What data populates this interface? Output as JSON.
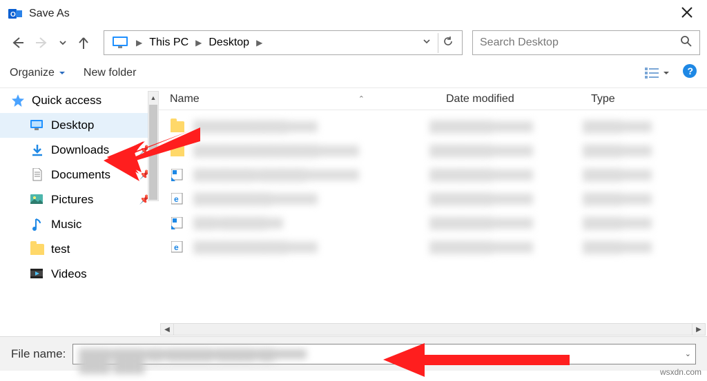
{
  "title": "Save As",
  "nav": {
    "back_enabled": true,
    "forward_enabled": false
  },
  "breadcrumb": {
    "root": "This PC",
    "location": "Desktop"
  },
  "search": {
    "placeholder": "Search Desktop"
  },
  "toolbar": {
    "organize": "Organize",
    "new_folder": "New folder"
  },
  "sidebar": {
    "quick_access": "Quick access",
    "items": [
      {
        "label": "Desktop",
        "pinned": true
      },
      {
        "label": "Downloads",
        "pinned": true
      },
      {
        "label": "Documents",
        "pinned": true
      },
      {
        "label": "Pictures",
        "pinned": true
      },
      {
        "label": "Music",
        "pinned": false
      },
      {
        "label": "test",
        "pinned": false
      },
      {
        "label": "Videos",
        "pinned": false
      }
    ]
  },
  "columns": {
    "name": "Name",
    "date": "Date modified",
    "type": "Type"
  },
  "footer": {
    "filename_label": "File name:"
  },
  "watermark": "wsxdn.com"
}
